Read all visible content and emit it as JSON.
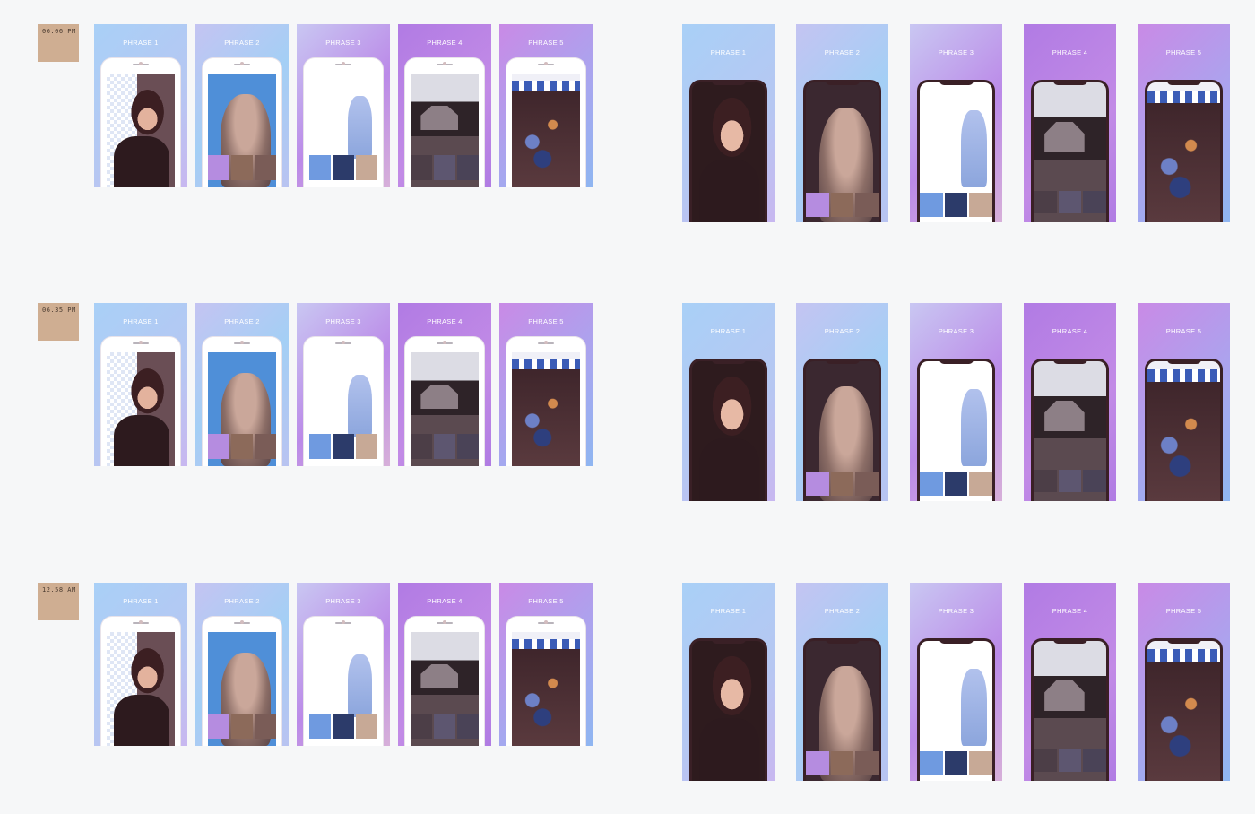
{
  "rows": [
    {
      "label": "06.06 PM"
    },
    {
      "label": "06.35 PM"
    },
    {
      "label": "12.58 AM"
    }
  ],
  "phrases": [
    "PHRASE 1",
    "PHRASE 2",
    "PHRASE 3",
    "PHRASE 4",
    "PHRASE 5"
  ],
  "colors": {
    "background": "#f6f7f8",
    "label_swatch": "#cfae92",
    "phone_x_frame": "#3a2026",
    "cat_backdrop": "#4f8fd8"
  },
  "screens": [
    "woman-portrait",
    "cat-portrait",
    "man-cutout",
    "house-and-car",
    "group-photo"
  ]
}
